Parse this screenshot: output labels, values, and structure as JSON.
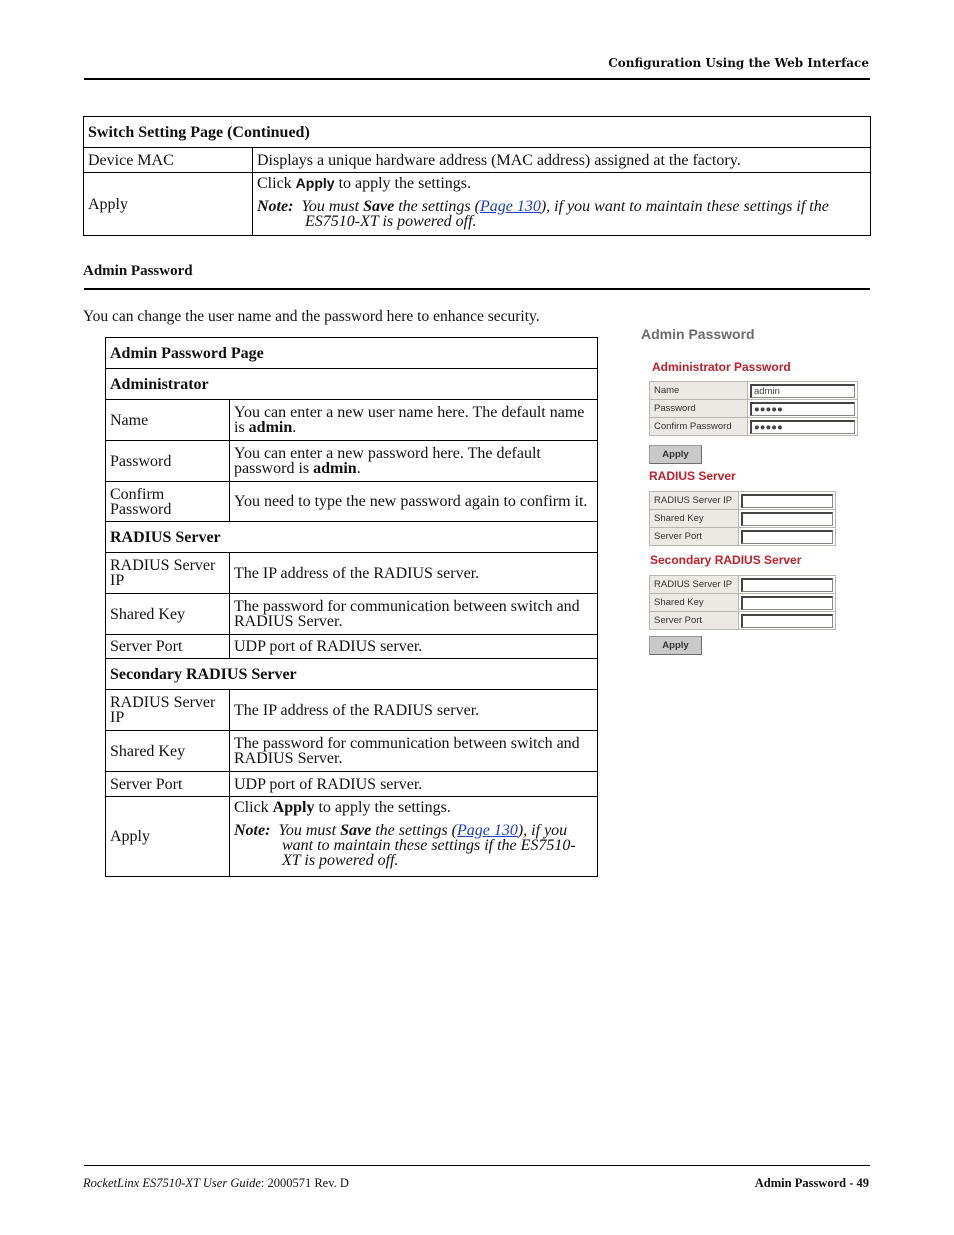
{
  "header": {
    "title": "Configuration Using the Web Interface"
  },
  "switch_table": {
    "title": "Switch Setting Page  (Continued)",
    "rows": [
      {
        "field": "Device MAC",
        "desc": "Displays a unique hardware address (MAC address) assigned at the factory."
      },
      {
        "field": "Apply",
        "desc_pre": "Click ",
        "desc_bold": "Apply",
        "desc_post": " to apply the settings.",
        "note_label": "Note:",
        "note_pre": "You must ",
        "note_bold": "Save",
        "note_mid": " the settings (",
        "note_link": "Page 130",
        "note_post": "), if you want to maintain these settings if the ES7510-XT is powered off."
      }
    ]
  },
  "section": {
    "title": "Admin Password",
    "intro": "You can change the user name and the password here to enhance security."
  },
  "admin_table": {
    "title": "Admin Password Page",
    "groups": [
      {
        "heading": "Administrator",
        "rows": [
          {
            "field": "Name",
            "desc_pre": "You can enter a new user name here. The default name is ",
            "desc_bold": "admin",
            "desc_post": "."
          },
          {
            "field": "Password",
            "desc_pre": "You can enter a new password here. The default password is ",
            "desc_bold": "admin",
            "desc_post": "."
          },
          {
            "field": "Confirm Password",
            "desc_pre": "You need to type the new password again to confirm it.",
            "desc_bold": "",
            "desc_post": ""
          }
        ]
      },
      {
        "heading": "RADIUS Server",
        "rows": [
          {
            "field": "RADIUS Server IP",
            "desc": "The IP address of the RADIUS server."
          },
          {
            "field": "Shared Key",
            "desc": "The password for communication between switch and RADIUS Server."
          },
          {
            "field": "Server Port",
            "desc": "UDP port of RADIUS server."
          }
        ]
      },
      {
        "heading": "Secondary RADIUS Server",
        "rows": [
          {
            "field": "RADIUS Server IP",
            "desc": "The IP address of the RADIUS server."
          },
          {
            "field": "Shared Key",
            "desc": "The password for communication between switch and RADIUS Server."
          },
          {
            "field": "Server Port",
            "desc": "UDP port of RADIUS server."
          }
        ]
      }
    ],
    "apply": {
      "field": "Apply",
      "desc_pre": "Click ",
      "desc_bold": "Apply",
      "desc_post": " to apply the settings.",
      "note_label": "Note:",
      "note_pre": "You must ",
      "note_bold": "Save",
      "note_mid": " the settings (",
      "note_link": "Page 130",
      "note_post": "), if you want to maintain these settings if the ES7510-XT is powered off."
    }
  },
  "web_ui": {
    "title": "Admin Password",
    "admin": {
      "heading": "Administrator Password",
      "fields": [
        {
          "label": "Name",
          "value": "admin"
        },
        {
          "label": "Password",
          "value": "●●●●●"
        },
        {
          "label": "Confirm Password",
          "value": "●●●●●"
        }
      ],
      "apply_label": "Apply"
    },
    "radius": {
      "heading": "RADIUS Server",
      "fields": [
        {
          "label": "RADIUS Server IP",
          "value": ""
        },
        {
          "label": "Shared Key",
          "value": ""
        },
        {
          "label": "Server Port",
          "value": ""
        }
      ]
    },
    "secondary": {
      "heading": "Secondary RADIUS Server",
      "fields": [
        {
          "label": "RADIUS Server IP",
          "value": ""
        },
        {
          "label": "Shared Key",
          "value": ""
        },
        {
          "label": "Server Port",
          "value": ""
        }
      ],
      "apply_label": "Apply"
    },
    "heading_color": "#c0202a",
    "title_color": "#6b6b6b"
  },
  "footer": {
    "product": "RocketLinx ES7510-XT  User Guide",
    "doc_id": ": 2000571 Rev. D",
    "page": "Admin Password - 49"
  }
}
